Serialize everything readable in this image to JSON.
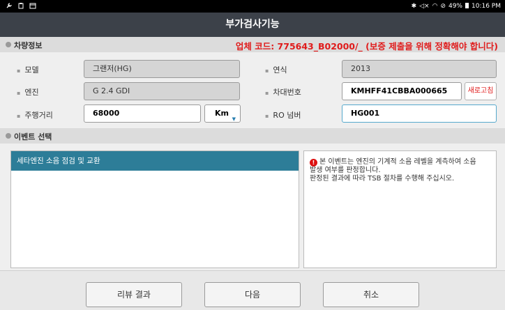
{
  "status_bar": {
    "left_icons": [
      "wrench-icon",
      "clipboard-icon",
      "calendar-icon"
    ],
    "right_icons": [
      "bluetooth-icon",
      "mute-icon",
      "wifi-icon",
      "alarm-icon"
    ],
    "battery": "49%",
    "time": "10:16 PM"
  },
  "title": "부가검사기능",
  "vehicle_section": {
    "label": "차량정보",
    "warning": "업체 코드: 775643_B02000/_ (보증 제출을 위해 정확해야 합니다)"
  },
  "fields": {
    "model_label": "모델",
    "model_value": "그랜저(HG)",
    "year_label": "연식",
    "year_value": "2013",
    "engine_label": "엔진",
    "engine_value": "G 2.4 GDI",
    "vin_label": "차대번호",
    "vin_value": "KMHFF41CBBA000665",
    "refresh_label": "새로고침",
    "mileage_label": "주행거리",
    "mileage_value": "68000",
    "unit_value": "Km",
    "ro_label": "RO 넘버",
    "ro_value": "HG001"
  },
  "event_section": {
    "label": "이벤트 선택",
    "items": [
      "세타엔진 소음 점검 및 교환"
    ],
    "description_line1": "본 이벤트는 엔진의 기계적 소음 레벨을 계측하여 소음",
    "description_line2": "발생 여부를 판정합니다.",
    "description_line3": "판정된 결과에 따라 TSB 절차를 수행해 주십시오."
  },
  "footer": {
    "review_label": "리뷰 결과",
    "next_label": "다음",
    "cancel_label": "취소"
  }
}
